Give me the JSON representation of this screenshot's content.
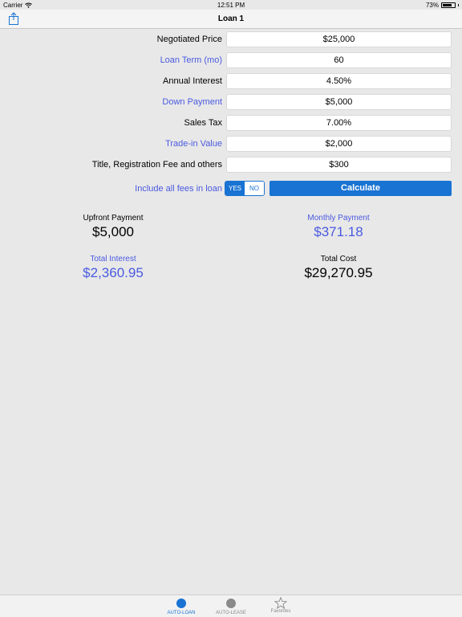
{
  "status_bar": {
    "carrier": "Carrier",
    "time": "12:51 PM",
    "battery": "73%"
  },
  "nav": {
    "title": "Loan 1",
    "share_icon": "share-icon"
  },
  "form": {
    "rows": [
      {
        "label": "Negotiated Price",
        "value": "$25,000",
        "label_color": "black"
      },
      {
        "label": "Loan Term (mo)",
        "value": "60",
        "label_color": "blue"
      },
      {
        "label": "Annual Interest",
        "value": "4.50%",
        "label_color": "black"
      },
      {
        "label": "Down Payment",
        "value": "$5,000",
        "label_color": "blue"
      },
      {
        "label": "Sales Tax",
        "value": "7.00%",
        "label_color": "black"
      },
      {
        "label": "Trade-in Value",
        "value": "$2,000",
        "label_color": "blue"
      },
      {
        "label": "Title, Registration Fee  and others",
        "value": "$300",
        "label_color": "black"
      }
    ],
    "fees_label": "Include all fees in loan",
    "fees_options": [
      "YES",
      "NO"
    ],
    "fees_selected": "YES",
    "calculate_label": "Calculate"
  },
  "results": {
    "upfront_label": "Upfront Payment",
    "upfront_value": "$5,000",
    "monthly_label": "Monthly Payment",
    "monthly_value": "$371.18",
    "interest_label": "Total Interest",
    "interest_value": "$2,360.95",
    "cost_label": "Total Cost",
    "cost_value": "$29,270.95"
  },
  "tabs": [
    {
      "label": "AUTO-LOAN",
      "icon": "circle-icon",
      "active": true
    },
    {
      "label": "AUTO-LEASE",
      "icon": "circle-icon",
      "active": false
    },
    {
      "label": "Favorites",
      "icon": "star-icon",
      "active": false
    }
  ],
  "colors": {
    "accent": "#1873d3",
    "label_blue": "#4a5ae0",
    "background": "#e8e8e8"
  }
}
